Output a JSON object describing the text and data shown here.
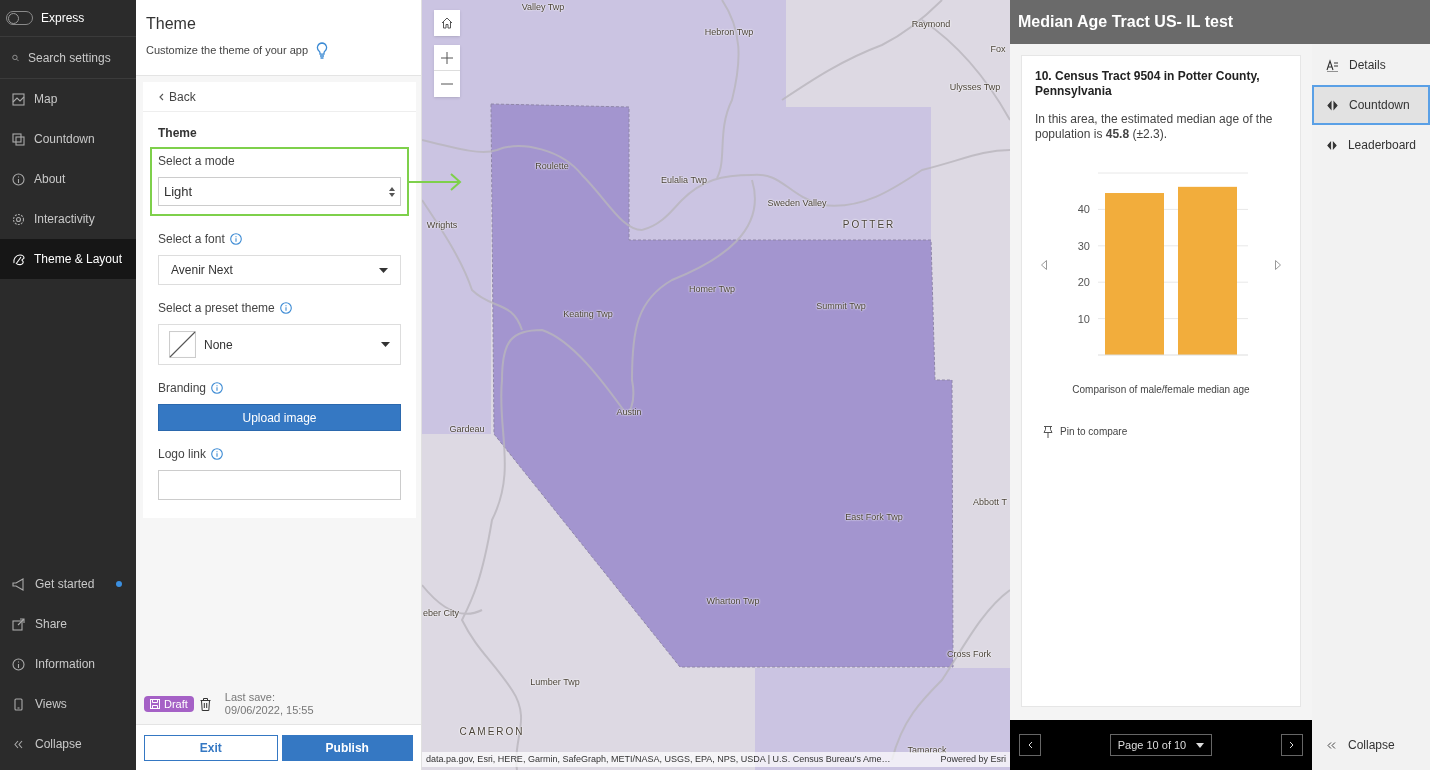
{
  "nav": {
    "express": {
      "label": "Express",
      "on": false
    },
    "search": {
      "placeholder": "Search settings"
    },
    "items": [
      {
        "label": "Map",
        "selected": false
      },
      {
        "label": "Countdown",
        "selected": false
      },
      {
        "label": "About",
        "selected": false
      },
      {
        "label": "Interactivity",
        "selected": false
      },
      {
        "label": "Theme & Layout",
        "selected": true
      }
    ],
    "footer_items": [
      {
        "label": "Get started",
        "notification": true
      },
      {
        "label": "Share",
        "notification": false
      },
      {
        "label": "Information",
        "notification": false
      },
      {
        "label": "Views",
        "notification": false
      },
      {
        "label": "Collapse",
        "notification": false
      }
    ]
  },
  "settings": {
    "title": "Theme",
    "subtitle": "Customize the theme of your app",
    "back": "Back",
    "section": "Theme",
    "fields": [
      {
        "kind": "stepper",
        "label": "Select a mode",
        "value": "Light",
        "info": false,
        "highlighted": true
      },
      {
        "kind": "select",
        "label": "Select a font",
        "value": "Avenir Next",
        "info": true,
        "highlighted": false
      },
      {
        "kind": "swatch",
        "label": "Select a preset theme",
        "value": "None",
        "info": true,
        "highlighted": false
      },
      {
        "kind": "button",
        "label": "Branding",
        "button_label": "Upload image",
        "info": true,
        "highlighted": false
      },
      {
        "kind": "input",
        "label": "Logo link",
        "info": true,
        "highlighted": false
      }
    ],
    "save": {
      "badge": "Draft",
      "label": "Last save:",
      "time": "09/06/2022, 15:55"
    },
    "actions": [
      {
        "label": "Exit",
        "kind": "secondary"
      },
      {
        "label": "Publish",
        "kind": "primary"
      }
    ]
  },
  "map": {
    "labels": [
      {
        "text": "Valley Twp",
        "kind": "place"
      },
      {
        "text": "Hebron Twp",
        "kind": "place"
      },
      {
        "text": "Raymond",
        "kind": "place"
      },
      {
        "text": "Fox",
        "kind": "place"
      },
      {
        "text": "Ulysses Twp",
        "kind": "place"
      },
      {
        "text": "Roulette",
        "kind": "place"
      },
      {
        "text": "Eulalia Twp",
        "kind": "place"
      },
      {
        "text": "Sweden Valley",
        "kind": "place"
      },
      {
        "text": "POTTER",
        "kind": "county"
      },
      {
        "text": "Wrights",
        "kind": "place"
      },
      {
        "text": "Homer Twp",
        "kind": "place"
      },
      {
        "text": "Keating Twp",
        "kind": "place"
      },
      {
        "text": "Summit Twp",
        "kind": "place"
      },
      {
        "text": "Austin",
        "kind": "place"
      },
      {
        "text": "Gardeau",
        "kind": "place"
      },
      {
        "text": "Abbott T",
        "kind": "place"
      },
      {
        "text": "East Fork Twp",
        "kind": "place"
      },
      {
        "text": "Wharton Twp",
        "kind": "place"
      },
      {
        "text": "eber City",
        "kind": "place"
      },
      {
        "text": "Cross Fork",
        "kind": "place"
      },
      {
        "text": "Lumber Twp",
        "kind": "place"
      },
      {
        "text": "CAMERON",
        "kind": "county"
      },
      {
        "text": "Tamarack",
        "kind": "place"
      }
    ],
    "attribution": "data.pa.gov, Esri, HERE, Garmin, SafeGraph, METI/NASA, USGS, EPA, NPS, USDA | U.S. Census Bureau's Ame…",
    "powered": "Powered by Esri"
  },
  "panel": {
    "title": "Median Age Tract US- IL test",
    "card": {
      "heading": "10. Census Tract 9504 in Potter County, Pennsylvania",
      "text": "In this area, the estimated median age of the population is **45.8** (±2.3).",
      "chart_data": {
        "type": "bar",
        "xlabel": "Comparison of male/female median age",
        "values": [
          44.5,
          46.2
        ],
        "grid": true,
        "ylim": [
          0,
          50
        ],
        "yticks": [
          10,
          20,
          30,
          40
        ]
      },
      "pin": "Pin to compare"
    },
    "pager": {
      "label": "Page 10 of 10"
    },
    "tabs": [
      {
        "label": "Details",
        "selected": false
      },
      {
        "label": "Countdown",
        "selected": true
      },
      {
        "label": "Leaderboard",
        "selected": false
      }
    ],
    "collapse": "Collapse"
  }
}
